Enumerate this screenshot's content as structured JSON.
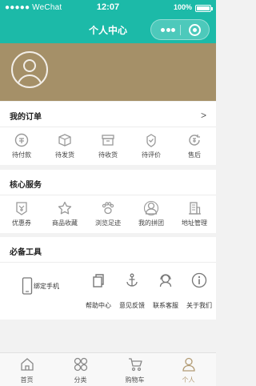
{
  "status_bar": {
    "carrier": "●●●●● WeChat",
    "time": "12:07",
    "battery": "100%"
  },
  "nav": {
    "title": "个人中心"
  },
  "orders": {
    "title": "我的订单",
    "chevron": ">",
    "items": [
      {
        "label": "待付款",
        "icon": "wallet-icon"
      },
      {
        "label": "待发货",
        "icon": "box-icon"
      },
      {
        "label": "待收货",
        "icon": "truck-icon"
      },
      {
        "label": "待评价",
        "icon": "rate-icon"
      },
      {
        "label": "售后",
        "icon": "after-sale-icon"
      }
    ]
  },
  "services": {
    "title": "核心服务",
    "items": [
      {
        "label": "优惠券",
        "icon": "coupon-icon"
      },
      {
        "label": "商品收藏",
        "icon": "star-icon"
      },
      {
        "label": "浏览足迹",
        "icon": "footprint-icon"
      },
      {
        "label": "我的拼团",
        "icon": "group-icon"
      },
      {
        "label": "地址管理",
        "icon": "address-icon"
      }
    ]
  },
  "tools": {
    "title": "必备工具",
    "bind_phone": "绑定手机",
    "items": [
      {
        "label": "帮助中心",
        "icon": "copy-icon"
      },
      {
        "label": "意见反馈",
        "icon": "anchor-icon"
      },
      {
        "label": "联系客服",
        "icon": "headset-icon"
      },
      {
        "label": "关于我们",
        "icon": "info-icon"
      }
    ]
  },
  "tabbar": {
    "items": [
      {
        "label": "首页",
        "icon": "home-icon"
      },
      {
        "label": "分类",
        "icon": "category-icon"
      },
      {
        "label": "购物车",
        "icon": "cart-icon"
      },
      {
        "label": "个人",
        "icon": "person-icon"
      }
    ],
    "active": "个人"
  },
  "colors": {
    "nav": "#1cbaa8",
    "banner": "#a59068",
    "active_tab": "#b29b74"
  }
}
